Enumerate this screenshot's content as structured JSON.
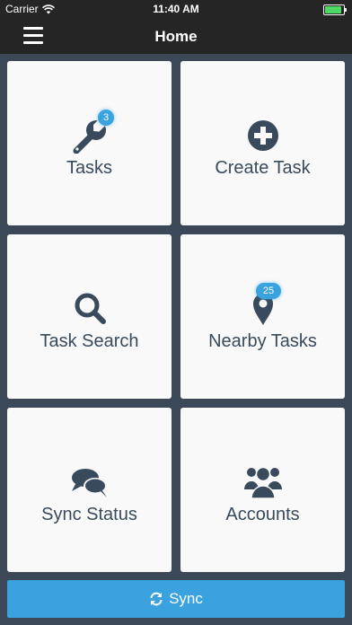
{
  "status_bar": {
    "carrier": "Carrier",
    "time": "11:40 AM",
    "battery_level": 1.0,
    "wifi_icon": "wifi-icon",
    "battery_icon": "battery-icon"
  },
  "nav": {
    "title": "Home",
    "menu_icon": "hamburger-icon"
  },
  "tiles": [
    {
      "label": "Tasks",
      "icon": "wrench-icon",
      "badge": "3"
    },
    {
      "label": "Create Task",
      "icon": "plus-circle-icon"
    },
    {
      "label": "Task Search",
      "icon": "search-icon"
    },
    {
      "label": "Nearby Tasks",
      "icon": "map-pin-icon",
      "badge": "25"
    },
    {
      "label": "Sync Status",
      "icon": "chat-bubbles-icon"
    },
    {
      "label": "Accounts",
      "icon": "users-icon"
    }
  ],
  "sync": {
    "label": "Sync",
    "icon": "refresh-icon"
  },
  "colors": {
    "background": "#3b4858",
    "bar": "#252525",
    "tile": "#f9f9f9",
    "icon": "#384a5c",
    "accent": "#3aa3df",
    "battery": "#4cd964"
  }
}
